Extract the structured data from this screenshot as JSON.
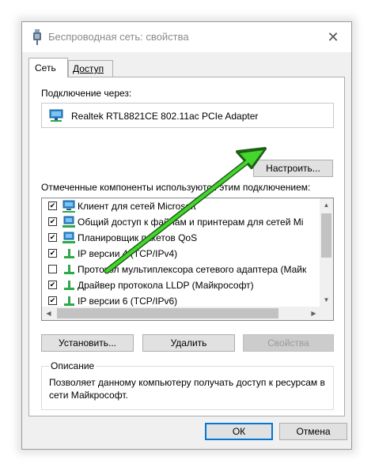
{
  "window": {
    "title": "Беспроводная сеть: свойства",
    "close_glyph": "✕",
    "title_icon": "network-adapter-icon"
  },
  "tabs": [
    {
      "label": "Сеть",
      "active": true
    },
    {
      "label": "Доступ",
      "active": false
    }
  ],
  "network": {
    "connect_via_label": "Подключение через:",
    "adapter_name": "Realtek RTL8821CE 802.11ac PCIe Adapter",
    "configure_button": "Настроить...",
    "components_label": "Отмеченные компоненты используются этим подключением:"
  },
  "components": [
    {
      "label": "Клиент для сетей Microsoft",
      "checked": true,
      "selected": false,
      "icon": "client-icon"
    },
    {
      "label": "Общий доступ к файлам и принтерам для сетей Mi",
      "checked": true,
      "selected": false,
      "icon": "service-icon"
    },
    {
      "label": "Планировщик пакетов QoS",
      "checked": true,
      "selected": false,
      "icon": "service-icon"
    },
    {
      "label": "IP версии 4 (TCP/IPv4)",
      "checked": true,
      "selected": false,
      "icon": "protocol-icon"
    },
    {
      "label": "Протокол мультиплексора сетевого адаптера (Майк",
      "checked": false,
      "selected": false,
      "icon": "protocol-icon"
    },
    {
      "label": "Драйвер протокола LLDP (Майкрософт)",
      "checked": true,
      "selected": false,
      "icon": "protocol-icon"
    },
    {
      "label": "IP версии 6 (TCP/IPv6)",
      "checked": true,
      "selected": false,
      "icon": "protocol-icon"
    }
  ],
  "actions": {
    "install": "Установить...",
    "remove": "Удалить",
    "properties": "Свойства"
  },
  "description": {
    "title": "Описание",
    "text": "Позволяет данному компьютеру получать доступ к ресурсам в сети Майкрософт."
  },
  "footer": {
    "ok": "ОК",
    "cancel": "Отмена"
  },
  "colors": {
    "annotation_arrow": "#44d62c",
    "selection": "#0078d7",
    "dialog_bg": "#f0f0f0"
  }
}
